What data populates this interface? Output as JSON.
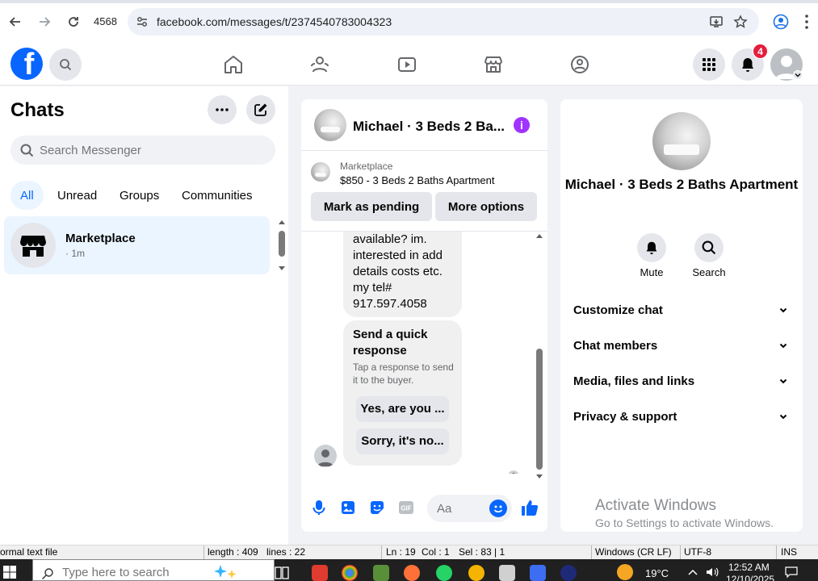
{
  "browser": {
    "tab_id": "4568",
    "url": "facebook.com/messages/t/2374540783004323"
  },
  "header": {
    "logo": "f",
    "notification_count": "4"
  },
  "left_panel": {
    "title": "Chats",
    "search_placeholder": "Search Messenger",
    "filters": [
      "All",
      "Unread",
      "Groups",
      "Communities"
    ],
    "active_filter": "All",
    "chats": [
      {
        "name": "Marketplace",
        "time": "· 1m"
      }
    ]
  },
  "conversation": {
    "title": "Michael · 3 Beds 2 Ba...",
    "marketplace_label": "Marketplace",
    "listing": "$850 - 3 Beds 2 Baths Apartment",
    "mark_pending_label": "Mark as pending",
    "more_options_label": "More options",
    "message_text": [
      "available? im.",
      "interested in add",
      "details costs etc.",
      "my tel#",
      "917.597.4058"
    ],
    "quick_response": {
      "title": "Send a quick response",
      "subtitle": "Tap a response to send it to the buyer.",
      "options": [
        "Yes, are you ...",
        "Sorry, it's no..."
      ]
    },
    "composer_placeholder": "Aa",
    "accent_color": "#0866ff"
  },
  "right_panel": {
    "name": "Michael · 3 Beds 2 Baths Apartment",
    "actions": [
      {
        "label": "Mute",
        "icon": "bell-icon"
      },
      {
        "label": "Search",
        "icon": "search-icon"
      }
    ],
    "sections": [
      "Customize chat",
      "Chat members",
      "Media, files and links",
      "Privacy & support"
    ]
  },
  "watermark": {
    "line1": "Activate Windows",
    "line2": "Go to Settings to activate Windows."
  },
  "status_bar": {
    "file_type": "ormal text file",
    "length": "length : 409",
    "lines": "lines : 22",
    "ln": "Ln : 19",
    "col": "Col : 1",
    "sel": "Sel : 83 | 1",
    "eol": "Windows (CR LF)",
    "encoding": "UTF-8",
    "mode": "INS"
  },
  "taskbar": {
    "search_placeholder": "Type here to search",
    "temperature": "19°C",
    "time": "12:52 AM",
    "date": "12/10/2025"
  }
}
